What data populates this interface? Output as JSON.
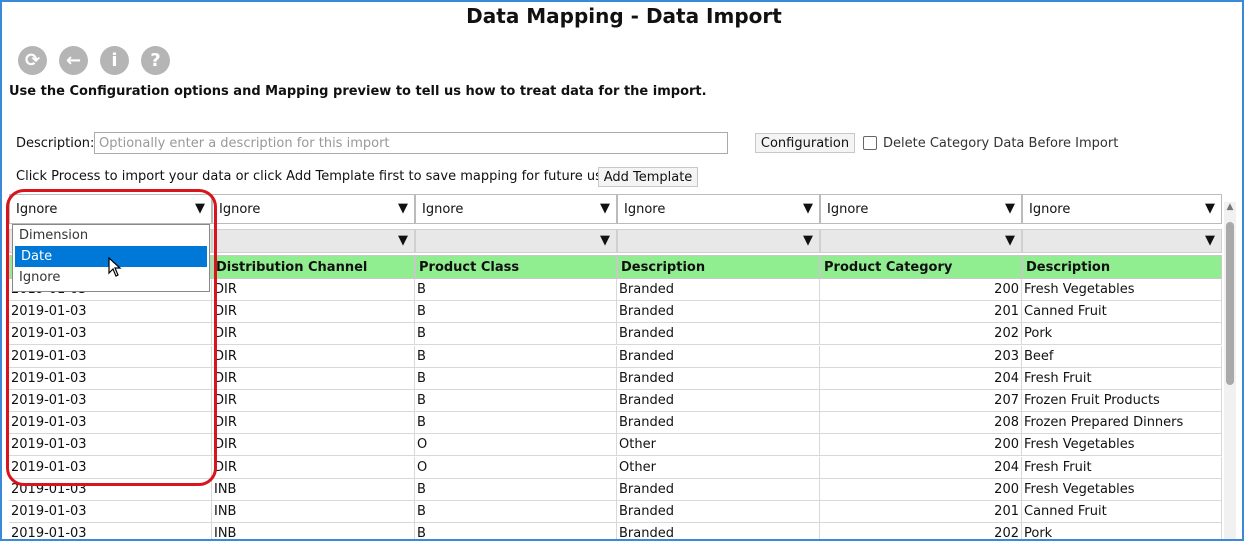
{
  "page": {
    "title": "Data Mapping - Data Import",
    "instruction": "Use the Configuration options and Mapping preview to tell us how to treat data for the import."
  },
  "toolbar": {
    "icons": [
      "refresh-icon",
      "back-icon",
      "info-icon",
      "help-icon"
    ],
    "glyphs": [
      "⟳",
      "←",
      "i",
      "?"
    ]
  },
  "form": {
    "description_label": "Description:",
    "description_placeholder": "Optionally enter a description for this import",
    "description_value": "",
    "configuration_button": "Configuration",
    "delete_checkbox_label": "Delete Category Data Before Import",
    "delete_checked": false,
    "process_text": "Click Process to import your data or click Add Template first to save mapping for future use.",
    "add_template_button": "Add Template"
  },
  "grid": {
    "column_types": [
      "Ignore",
      "Ignore",
      "Ignore",
      "Ignore",
      "Ignore",
      "Ignore"
    ],
    "headers": [
      "",
      "Distribution Channel",
      "Product Class",
      "Description",
      "Product Category",
      "Description"
    ],
    "rows": [
      [
        "2019-01-03",
        "DIR",
        "B",
        "Branded",
        "200",
        "Fresh Vegetables"
      ],
      [
        "2019-01-03",
        "DIR",
        "B",
        "Branded",
        "201",
        "Canned Fruit"
      ],
      [
        "2019-01-03",
        "DIR",
        "B",
        "Branded",
        "202",
        "Pork"
      ],
      [
        "2019-01-03",
        "DIR",
        "B",
        "Branded",
        "203",
        "Beef"
      ],
      [
        "2019-01-03",
        "DIR",
        "B",
        "Branded",
        "204",
        "Fresh Fruit"
      ],
      [
        "2019-01-03",
        "DIR",
        "B",
        "Branded",
        "207",
        "Frozen Fruit Products"
      ],
      [
        "2019-01-03",
        "DIR",
        "B",
        "Branded",
        "208",
        "Frozen Prepared Dinners"
      ],
      [
        "2019-01-03",
        "DIR",
        "O",
        "Other",
        "200",
        "Fresh Vegetables"
      ],
      [
        "2019-01-03",
        "DIR",
        "O",
        "Other",
        "204",
        "Fresh Fruit"
      ],
      [
        "2019-01-03",
        "INB",
        "B",
        "Branded",
        "200",
        "Fresh Vegetables"
      ],
      [
        "2019-01-03",
        "INB",
        "B",
        "Branded",
        "201",
        "Canned Fruit"
      ],
      [
        "2019-01-03",
        "INB",
        "B",
        "Branded",
        "202",
        "Pork"
      ]
    ],
    "dropdown_open": {
      "options": [
        "Dimension",
        "Date",
        "Ignore"
      ],
      "selected": "Date"
    }
  },
  "colors": {
    "header_bg": "#90ee90",
    "selected_option": "#0078d7",
    "highlight": "#d8141c",
    "frame": "#3b8ad9"
  }
}
